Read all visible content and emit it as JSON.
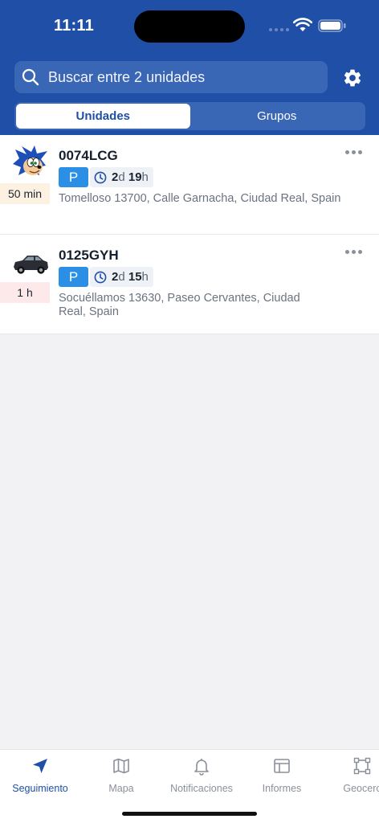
{
  "status_bar": {
    "time": "11:11"
  },
  "search": {
    "placeholder": "Buscar entre 2 unidades"
  },
  "tabs": [
    {
      "label": "Unidades",
      "active": true
    },
    {
      "label": "Grupos",
      "active": false
    }
  ],
  "units": [
    {
      "name": "0074LCG",
      "avatar": "sonic-avatar",
      "age": "50 min",
      "age_color": "#fdf2e2",
      "status": "P",
      "duration_days": "2",
      "duration_days_unit": "d",
      "duration_hours": "19",
      "duration_hours_unit": "h",
      "address": "Tomelloso 13700, Calle Garnacha, Ciudad Real, Spain"
    },
    {
      "name": "0125GYH",
      "avatar": "car-avatar",
      "age": "1 h",
      "age_color": "#fde9ea",
      "status": "P",
      "duration_days": "2",
      "duration_days_unit": "d",
      "duration_hours": "15",
      "duration_hours_unit": "h",
      "address": "Socuéllamos 13630, Paseo Cervantes, Ciudad Real, Spain"
    }
  ],
  "nav": [
    {
      "label": "Seguimiento",
      "icon": "navigation-arrow-icon",
      "active": true
    },
    {
      "label": "Mapa",
      "icon": "map-icon",
      "active": false
    },
    {
      "label": "Notificaciones",
      "icon": "bell-icon",
      "active": false
    },
    {
      "label": "Informes",
      "icon": "report-table-icon",
      "active": false
    },
    {
      "label": "Geocerc",
      "icon": "geofence-icon",
      "active": false
    }
  ],
  "colors": {
    "header": "#1f4fa6",
    "accent": "#1f4fa6",
    "status_parked": "#2b8fe6"
  }
}
